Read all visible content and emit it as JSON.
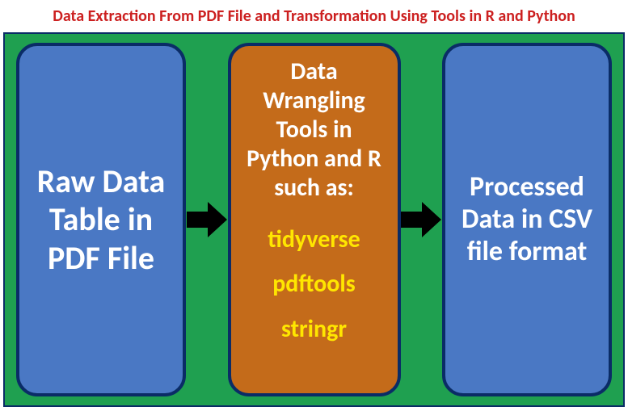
{
  "title": "Data Extraction From PDF File and Transformation Using Tools in R and Python",
  "left_box": {
    "text": "Raw Data Table in PDF File"
  },
  "mid_box": {
    "heading": "Data Wrangling Tools in Python and R such as:",
    "tools": [
      "tidyverse",
      "pdftools",
      "stringr"
    ]
  },
  "right_box": {
    "text": "Processed Data in CSV file format"
  },
  "colors": {
    "title": "#cc2020",
    "canvas_bg": "#1fa050",
    "box_blue": "#4a78c4",
    "box_orange": "#c46b1a",
    "border": "#0a2c66",
    "tool_text": "#ffe600",
    "arrow": "#000000"
  }
}
